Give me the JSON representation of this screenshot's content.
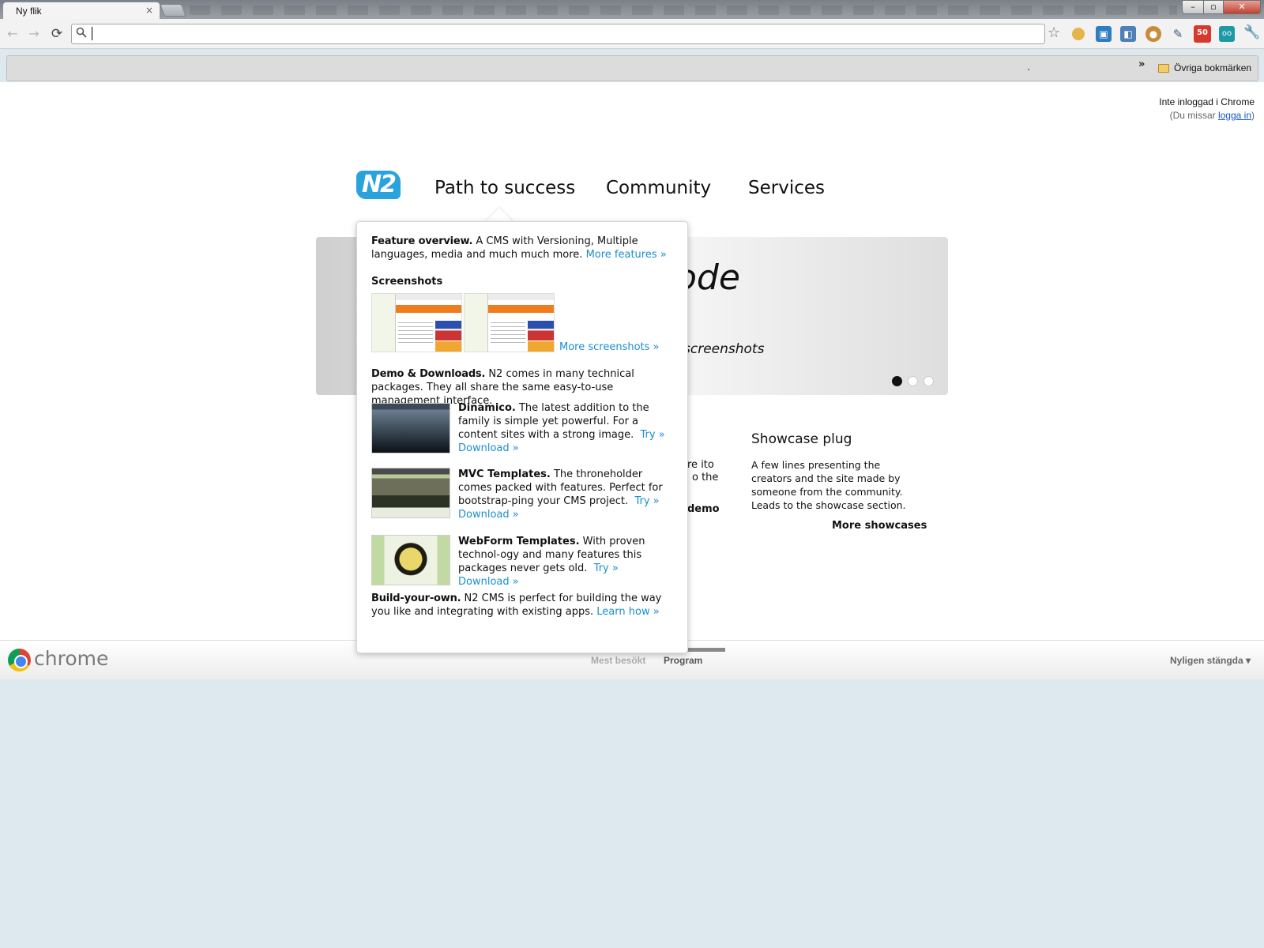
{
  "browser": {
    "tab_title": "Ny flik",
    "tab_close": "×",
    "window_buttons": {
      "minimize": "–",
      "maximize": "▫",
      "close": "✕"
    },
    "address_value": "",
    "bookmarks_overflow": "»",
    "bookmarks_dot": ".",
    "other_bookmarks": "Övriga bokmärken",
    "extension_badge": "50",
    "extension_reader": "oo"
  },
  "signin": {
    "line1": "Inte inloggad i Chrome",
    "line2_prefix": "(Du missar ",
    "line2_link": "logga in",
    "line2_suffix": ")"
  },
  "site": {
    "logo": "N2",
    "nav": [
      "Path to success",
      "Community",
      "Services"
    ],
    "hero": {
      "title_fragment": "ode",
      "subtitle_fragment": "screenshots"
    },
    "demo_fragments": [
      "re ito",
      "o the",
      "demo"
    ],
    "showcase": {
      "title": "Showcase plug",
      "text": "A few lines presenting the creators and the site made by someone from the community. Leads to the showcase section.",
      "more": "More showcases"
    }
  },
  "dropdown": {
    "feature": {
      "heading": "Feature overview.",
      "text": " A CMS with Versioning, Multiple languages, media and much much more. ",
      "link": "More features »"
    },
    "screenshots": {
      "title": "Screenshots",
      "more": "More screenshots »"
    },
    "demo": {
      "heading": "Demo & Downloads.",
      "text": " N2 comes in many technical packages. They all share the same easy-to-use management interface."
    },
    "items": [
      {
        "name": "Dinamico.",
        "text": " The latest addition to the family is simple yet powerful. For a content sites with a strong image.",
        "try": "Try »",
        "download": "Download »"
      },
      {
        "name": "MVC Templates.",
        "text": " The throneholder comes packed with features. Perfect for bootstrap-ping your CMS project.",
        "try": "Try »",
        "download": "Download »"
      },
      {
        "name": "WebForm Templates.",
        "text": " With proven technol-ogy and many features this packages never gets old.",
        "try": "Try »",
        "download": "Download »"
      }
    ],
    "build": {
      "heading": "Build-your-own.",
      "text": " N2 CMS is perfect for building the way you like and integrating with existing apps. ",
      "link": "Learn how »"
    }
  },
  "ntp": {
    "wordmark": "chrome",
    "most_visited": "Mest besökt",
    "apps": "Program",
    "recently_closed": "Nyligen stängda ▾"
  }
}
